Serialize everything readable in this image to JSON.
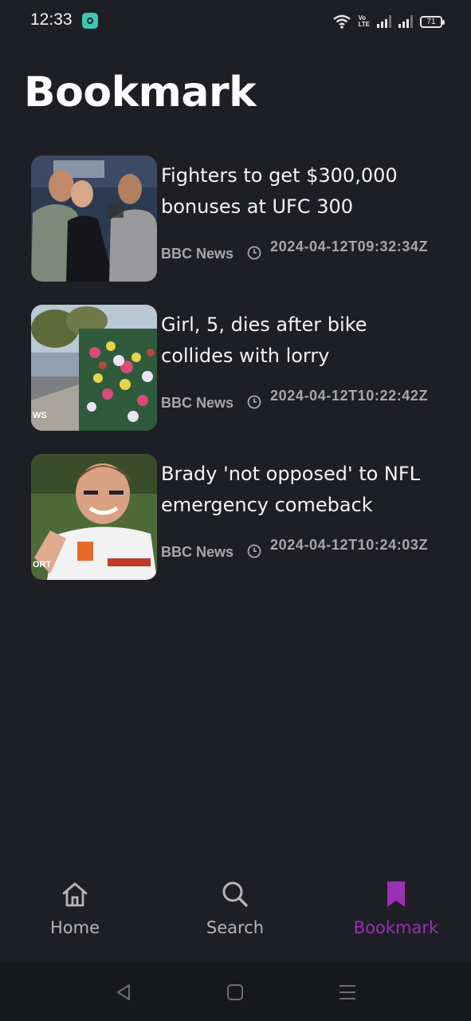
{
  "status_bar": {
    "time": "12:33",
    "battery": "71",
    "volte": [
      "Vo",
      "LTE"
    ]
  },
  "page": {
    "title": "Bookmark"
  },
  "articles": [
    {
      "title": "Fighters to get $300,000 bonuses at UFC 300",
      "source": "BBC News",
      "date": "2024-04-12T09:32:34Z",
      "image_text": ""
    },
    {
      "title": "Girl, 5, dies after bike collides with lorry",
      "source": "BBC News",
      "date": "2024-04-12T10:22:42Z",
      "image_text": "WS"
    },
    {
      "title": "Brady 'not opposed' to NFL emergency comeback",
      "source": "BBC News",
      "date": "2024-04-12T10:24:03Z",
      "image_text": "ORT"
    }
  ],
  "bottom_nav": {
    "items": [
      {
        "label": "Home",
        "icon": "home-icon"
      },
      {
        "label": "Search",
        "icon": "search-icon"
      },
      {
        "label": "Bookmark",
        "icon": "bookmark-icon",
        "active": true
      }
    ],
    "active_color": "#9b2fb5",
    "inactive_color": "#b5b5b8"
  },
  "system_nav": {
    "buttons": [
      "back-icon",
      "home-square-icon",
      "menu-icon"
    ]
  }
}
